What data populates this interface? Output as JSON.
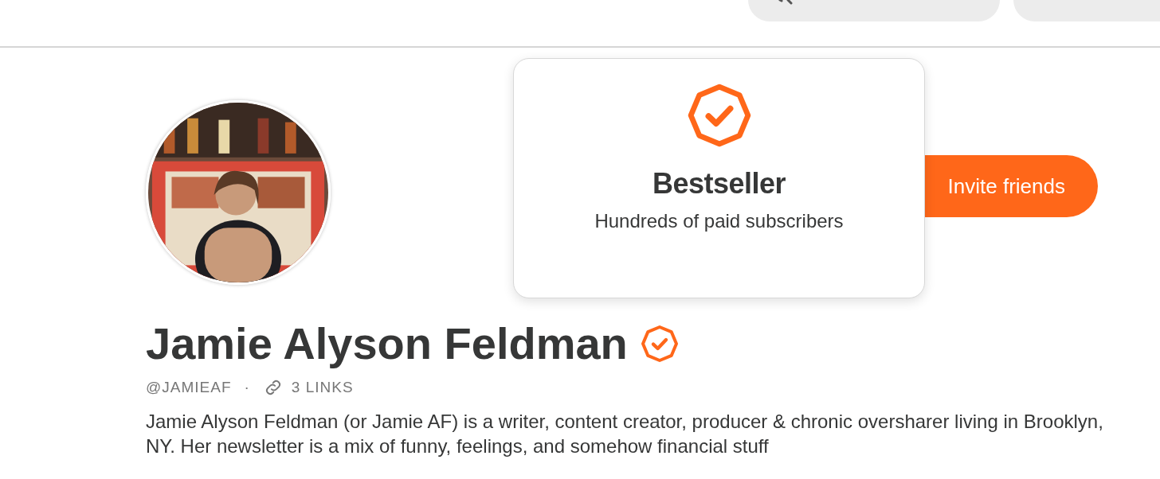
{
  "header": {
    "search": {
      "kind": "search"
    },
    "pill_2": {
      "kind": "pill"
    }
  },
  "profile": {
    "invite_button": "Invite friends",
    "name": "Jamie Alyson Feldman",
    "verified": true,
    "handle": "@JAMIEAF",
    "separator": "·",
    "links": "3 LINKS",
    "bio": "Jamie Alyson Feldman (or Jamie AF) is a writer, content creator, producer & chronic oversharer living in Brooklyn, NY. Her newsletter is a mix of funny, feelings, and somehow financial stuff"
  },
  "tooltip": {
    "title": "Bestseller",
    "subtitle": "Hundreds of paid subscribers"
  }
}
